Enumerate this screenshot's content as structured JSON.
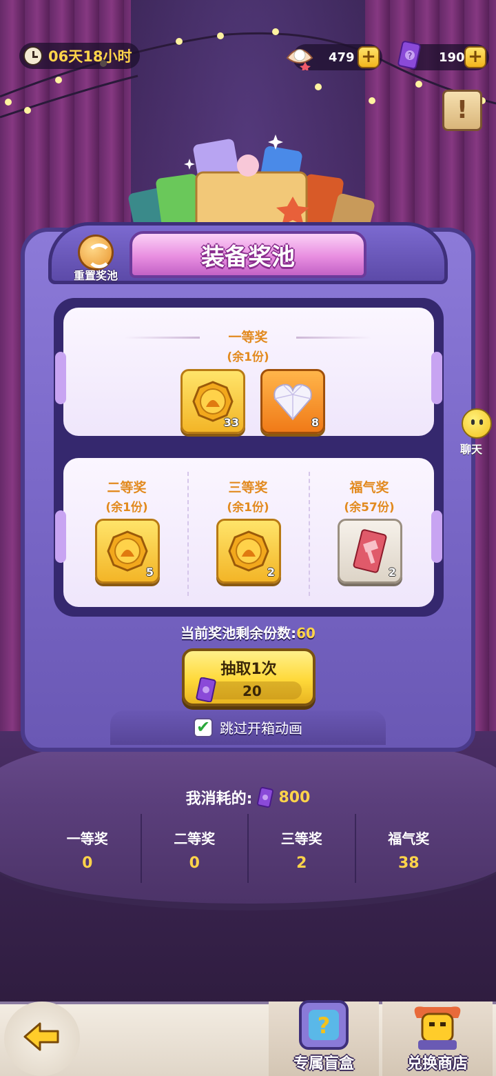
{
  "topbar": {
    "timer": "06天18小时",
    "pearl_count": "479",
    "ticket_count": "190",
    "plus_symbol": "+",
    "notice_symbol": "!"
  },
  "pool": {
    "title": "装备奖池",
    "reset_label": "重置奖池",
    "first_prize": {
      "name": "一等奖",
      "remain": "(余1份)",
      "items": [
        {
          "icon": "gold-coin-icon",
          "count": "33"
        },
        {
          "icon": "heart-diamond-icon",
          "count": "8"
        }
      ]
    },
    "second_prize": {
      "name": "二等奖",
      "remain": "(余1份)",
      "item": {
        "icon": "gold-coin-icon",
        "count": "5"
      }
    },
    "third_prize": {
      "name": "三等奖",
      "remain": "(余1份)",
      "item": {
        "icon": "gold-coin-icon",
        "count": "2"
      }
    },
    "lucky_prize": {
      "name": "福气奖",
      "remain": "(余57份)",
      "item": {
        "icon": "red-hammer-ticket-icon",
        "count": "2"
      }
    },
    "remaining_label": "当前奖池剩余份数:",
    "remaining_value": "60"
  },
  "draw": {
    "label": "抽取1次",
    "cost": "20",
    "skip_label": "跳过开箱动画",
    "skip_checked": true,
    "check_symbol": "✔"
  },
  "consumed": {
    "label": "我消耗的:",
    "value": "800"
  },
  "stats": [
    {
      "label": "一等奖",
      "value": "0"
    },
    {
      "label": "二等奖",
      "value": "0"
    },
    {
      "label": "三等奖",
      "value": "2"
    },
    {
      "label": "福气奖",
      "value": "38"
    }
  ],
  "chat": {
    "label": "聊天"
  },
  "bottom_nav": {
    "blind_box": "专属盲盒",
    "shop": "兑换商店"
  },
  "colors": {
    "accent_gold": "#ffd44a",
    "prize_orange": "#e28a1e",
    "machine_purple": "#7a68c8",
    "banner_pink": "#e88ee0"
  }
}
